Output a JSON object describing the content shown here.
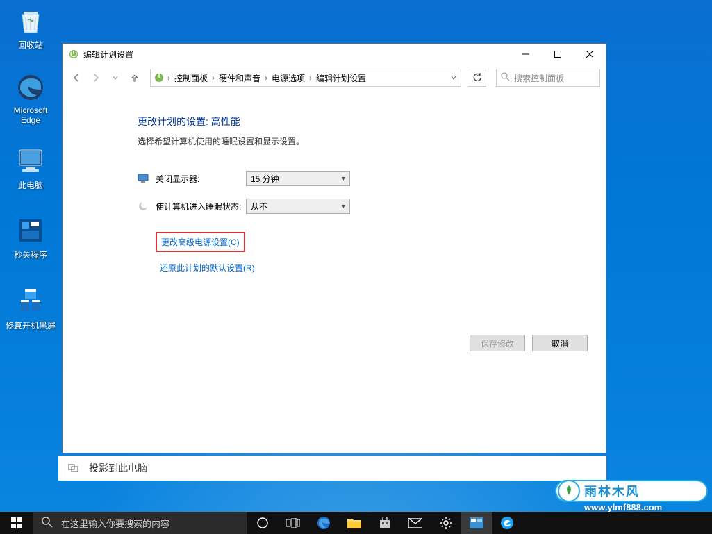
{
  "desktop": {
    "icons": {
      "recycle": "回收站",
      "edge": "Microsoft Edge",
      "pc": "此电脑",
      "app1": "秒关程序",
      "repair": "修复开机黑屏"
    }
  },
  "settings_strip": {
    "label": "投影到此电脑"
  },
  "window": {
    "title": "编辑计划设置",
    "breadcrumbs": {
      "c1": "控制面板",
      "c2": "硬件和声音",
      "c3": "电源选项",
      "c4": "编辑计划设置"
    },
    "search_placeholder": "搜索控制面板",
    "heading": "更改计划的设置: 高性能",
    "subheading": "选择希望计算机使用的睡眠设置和显示设置。",
    "row_display": {
      "label": "关闭显示器:",
      "value": "15 分钟"
    },
    "row_sleep": {
      "label": "使计算机进入睡眠状态:",
      "value": "从不"
    },
    "link_advanced": "更改高级电源设置(C)",
    "link_restore": "还原此计划的默认设置(R)",
    "btn_save": "保存修改",
    "btn_cancel": "取消"
  },
  "taskbar": {
    "search_placeholder": "在这里输入你要搜索的内容"
  },
  "watermark": {
    "brand": "雨林木风",
    "url": "www.ylmf888.com"
  }
}
